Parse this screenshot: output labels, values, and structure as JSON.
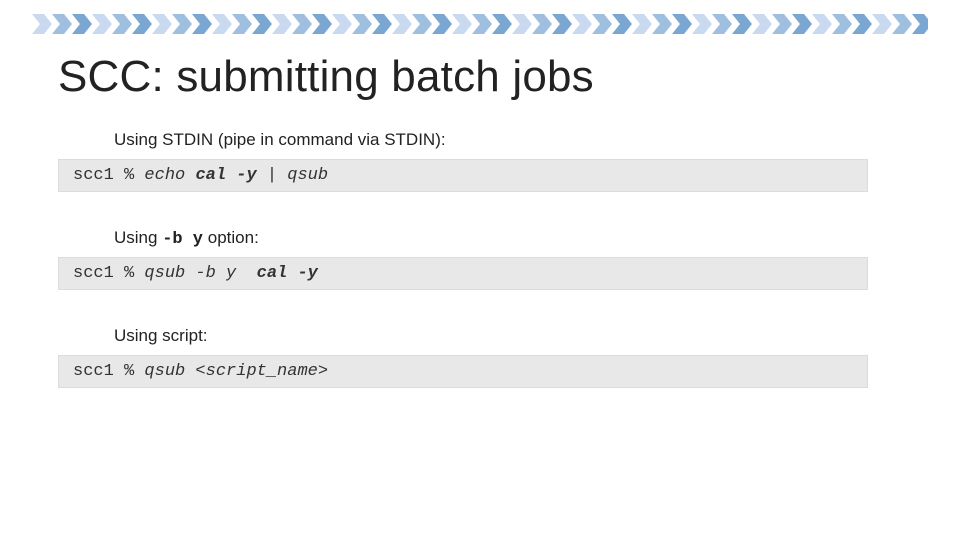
{
  "title": "SCC: submitting batch jobs",
  "sections": [
    {
      "label_prefix": "Using STDIN  (pipe in command via STDIN):",
      "label_mono": "",
      "label_suffix": "",
      "prompt": "scc1 % ",
      "cmd_plain_pre": "echo ",
      "cmd_bold": "cal -y",
      "cmd_plain_post": " | qsub"
    },
    {
      "label_prefix": "Using",
      "label_mono": "-b y",
      "label_suffix": " option:",
      "prompt": "scc1 % ",
      "cmd_plain_pre": "qsub -b y  ",
      "cmd_bold": "cal -y",
      "cmd_plain_post": ""
    },
    {
      "label_prefix": "Using script:",
      "label_mono": "",
      "label_suffix": "",
      "prompt": "scc1 % ",
      "cmd_plain_pre": "qsub <script_name>",
      "cmd_bold": "",
      "cmd_plain_post": ""
    }
  ]
}
